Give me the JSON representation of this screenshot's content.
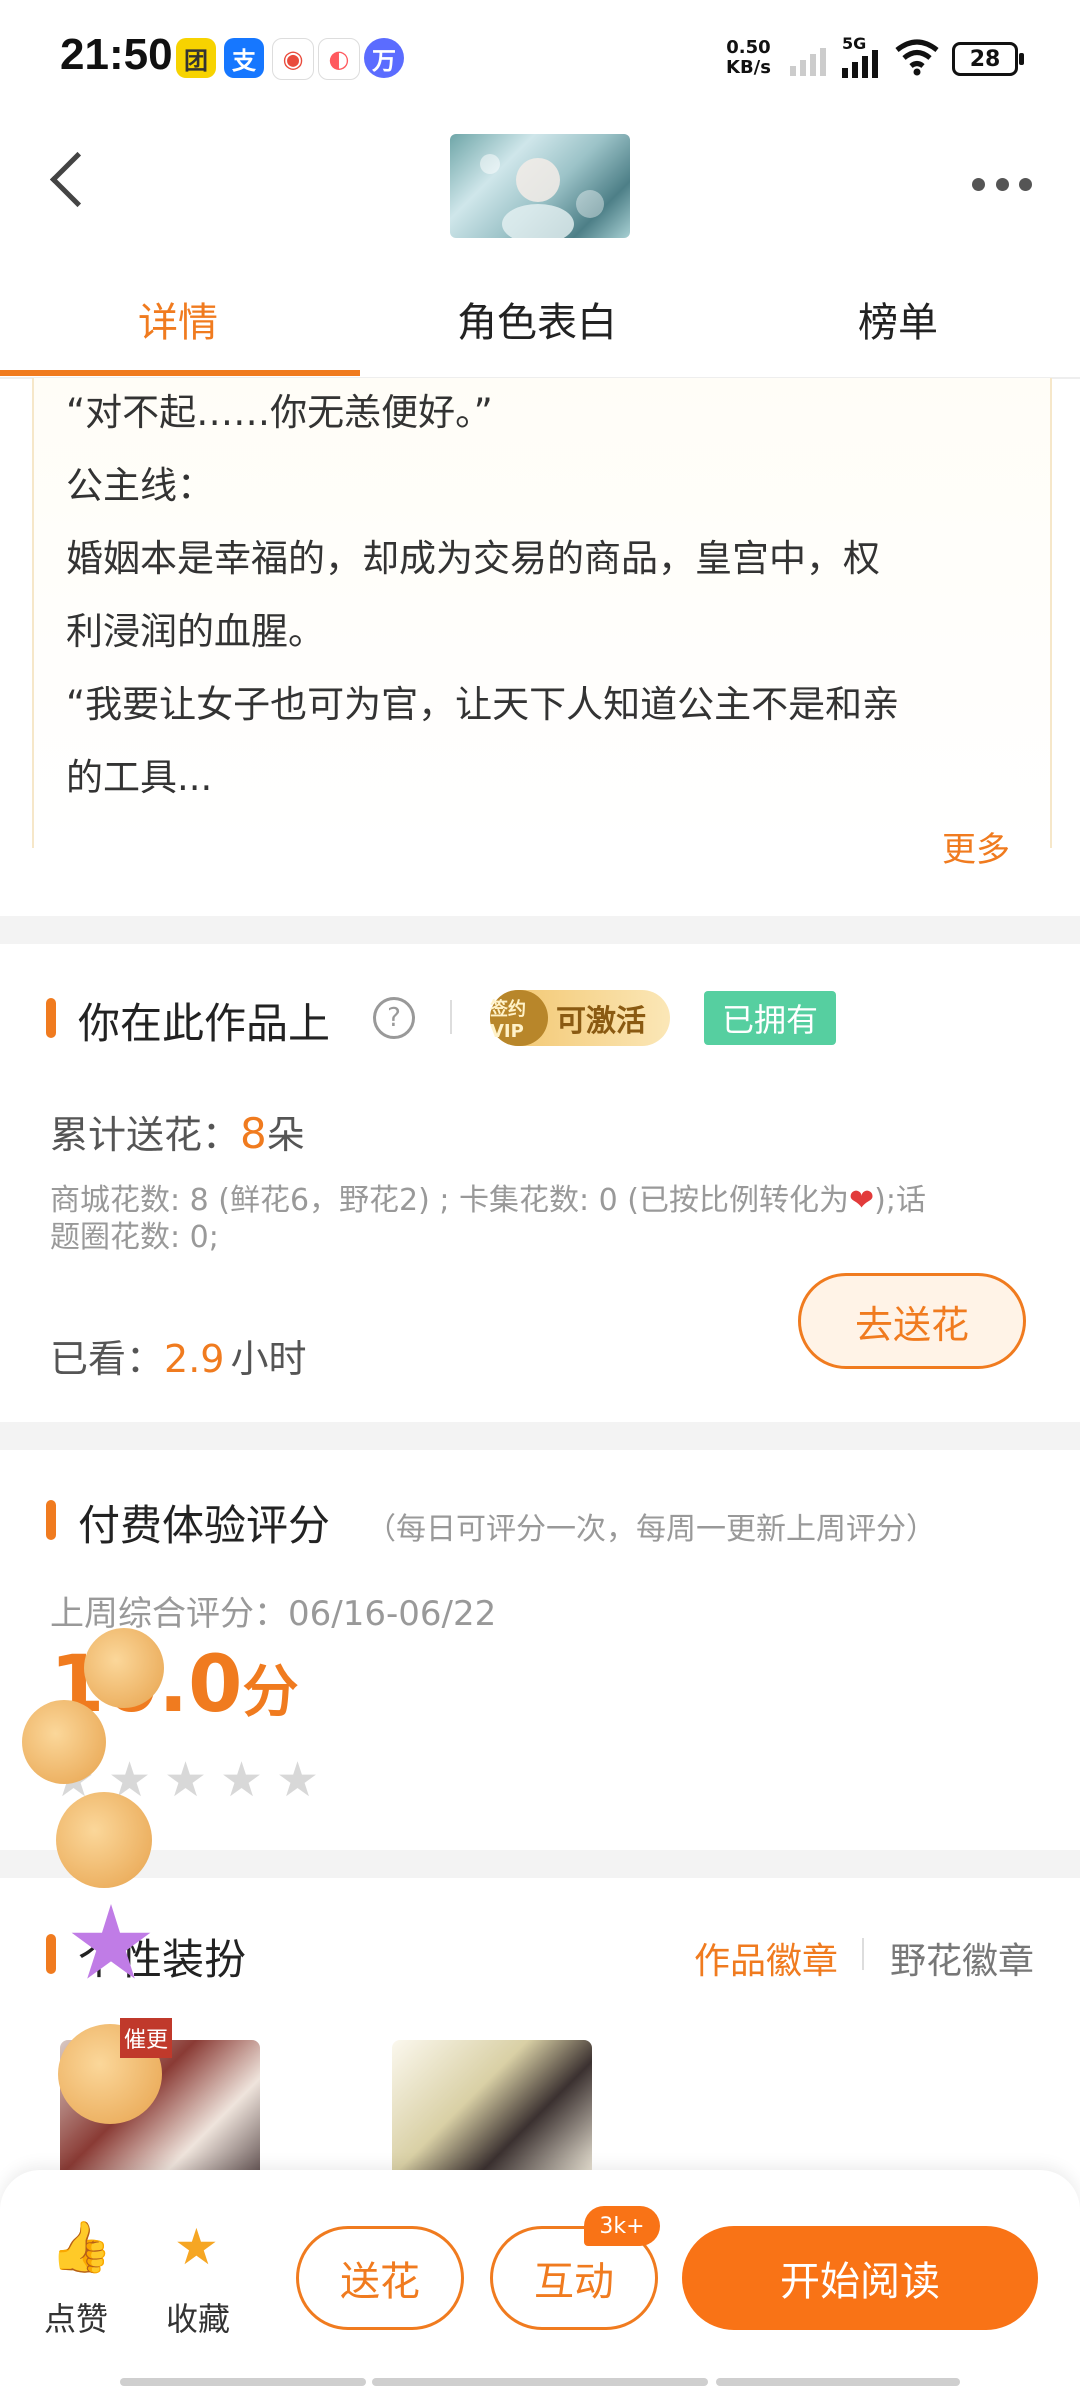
{
  "status": {
    "time": "21:50",
    "net_speed_top": "0.50",
    "net_speed_unit": "KB/s",
    "network_type": "5G",
    "battery": "28",
    "app_icons": [
      {
        "name": "meituan-app-icon",
        "glyph": "团",
        "color": "#f7d300"
      },
      {
        "name": "alipay-app-icon",
        "glyph": "支",
        "color": "#1677ff"
      },
      {
        "name": "map-app-icon",
        "glyph": "◉",
        "color": "#e94b3c"
      },
      {
        "name": "browser-app-icon",
        "glyph": "◐",
        "color": "#ff5a5f"
      },
      {
        "name": "wan-app-icon",
        "glyph": "万",
        "color": "#5b6cff"
      }
    ]
  },
  "tabs": [
    {
      "label": "详情",
      "active": true
    },
    {
      "label": "角色表白",
      "active": false
    },
    {
      "label": "榜单",
      "active": false
    }
  ],
  "synopsis": {
    "lines": [
      "“对不起……你无恙便好。”",
      "公主线：",
      "婚姻本是幸福的，却成为交易的商品，皇宫中，权",
      "利浸润的血腥。",
      "“我要让女子也可为官，让天下人知道公主不是和亲",
      "的工具..."
    ],
    "more_label": "更多"
  },
  "user_section": {
    "title": "你在此作品上",
    "help_icon": "?",
    "vip_seal": "签约VIP",
    "vip_label": "可激活",
    "owned_label": "已拥有",
    "flowers_label": "累计送花：",
    "flowers_value": "8",
    "flowers_unit": "朵",
    "flowers_detail_line1_a": "商城花数: 8 (鲜花6，野花2) ; 卡集花数: 0 (已按比例转化为",
    "flowers_detail_line1_heart": "❤",
    "flowers_detail_line1_b": ");话",
    "flowers_detail_line2": "题圈花数: 0;",
    "watched_label": "已看：",
    "watched_value": "2.9",
    "watched_unit": "小时",
    "send_flower_button": "去送花"
  },
  "rating_section": {
    "title": "付费体验评分",
    "subtitle": "（每日可评分一次，每周一更新上周评分）",
    "period_label": "上周综合评分：06/16-06/22",
    "score": "10.0",
    "score_unit": "分",
    "stars_total": 5
  },
  "dress_section": {
    "title": "个性装扮",
    "tab_work_badge": "作品徽章",
    "tab_wildflower_badge": "野花徽章",
    "deco_sign_text": "催更"
  },
  "bottom_bar": {
    "like_label": "点赞",
    "collect_label": "收藏",
    "flower_button": "送花",
    "interact_button": "互动",
    "interact_count": "3k+",
    "read_button": "开始阅读"
  },
  "colors": {
    "accent": "#f07b1f",
    "owned_green": "#56cfa0"
  }
}
